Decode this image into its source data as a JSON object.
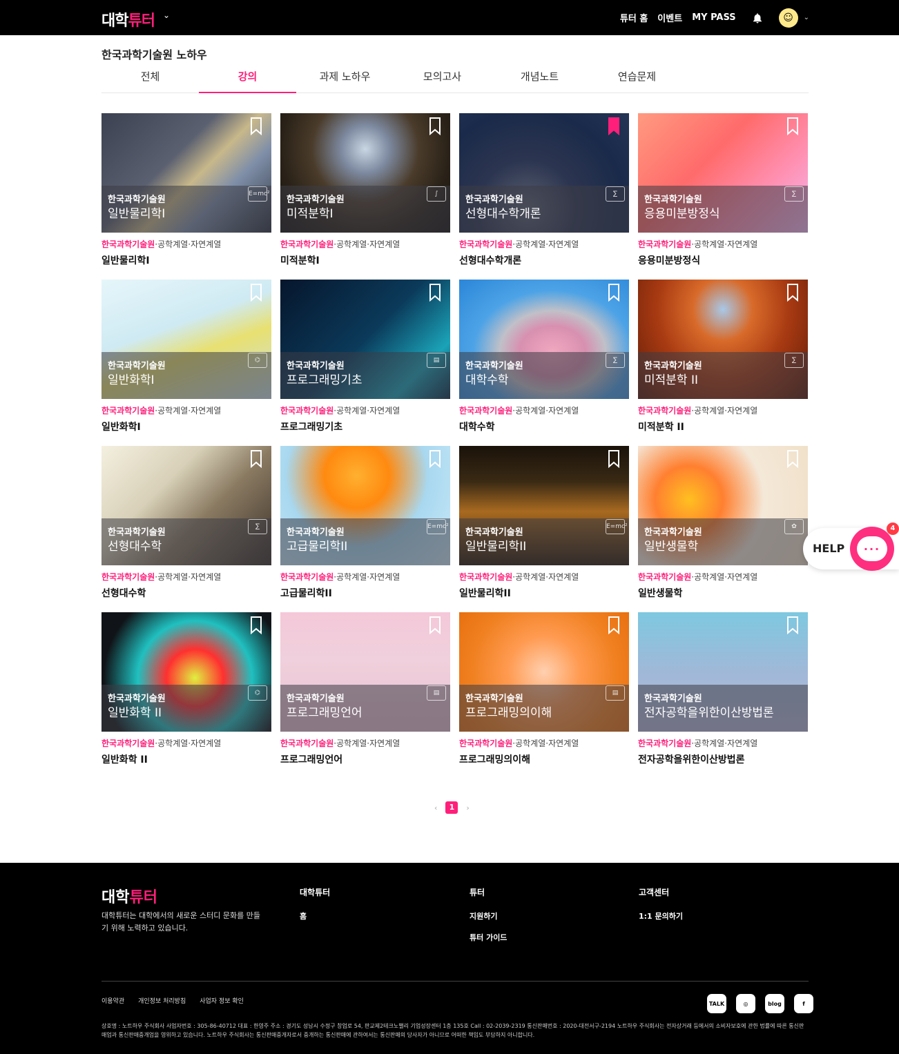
{
  "header": {
    "logo_main": "대학",
    "logo_accent": "튜터",
    "links": [
      "튜터 홈",
      "이벤트",
      "MY PASS"
    ]
  },
  "page": {
    "title": "한국과학기술원 노하우",
    "tabs": [
      "전체",
      "강의",
      "과제 노하우",
      "모의고사",
      "개념노트",
      "연습문제"
    ],
    "active_tab": "강의"
  },
  "cards": [
    {
      "uni": "한국과학기술원",
      "name": "일반물리학I",
      "tags": "·공학계열·자연계열",
      "title": "일반물리학I",
      "icon": "E=mc²",
      "bookmarked": false,
      "bg": "linear-gradient(135deg,#3b4150 0%,#5b6070 40%,#c8b88a 55%,#7f8fa8 70%,#2e3440 100%)"
    },
    {
      "uni": "한국과학기술원",
      "name": "미적분학I",
      "tags": "·공학계열·자연계열",
      "title": "미적분학I",
      "icon": "∫",
      "bookmarked": false,
      "bg": "radial-gradient(circle at 50% 30%,#c9d6e3 0%,#7d8aa0 20%,#4a3b2a 45%,#2a2218 70%,#151210 100%)"
    },
    {
      "uni": "한국과학기술원",
      "name": "선형대수학개론",
      "tags": "·공학계열·자연계열",
      "title": "선형대수학개론",
      "icon": "∑",
      "bookmarked": true,
      "bg": "radial-gradient(circle at 40% 80%,#5a6070 0%,#2c3550 35%,#1a2a4a 70%,#243556 100%)"
    },
    {
      "uni": "한국과학기술원",
      "name": "응용미분방정식",
      "tags": "·공학계열·자연계열",
      "title": "응용미분방정식",
      "icon": "∑",
      "bookmarked": false,
      "bg": "linear-gradient(135deg,#ff9a80 0%,#ff6b6b 40%,#ff8fb0 70%,#f3b8f0 100%)"
    },
    {
      "uni": "한국과학기술원",
      "name": "일반화학I",
      "tags": "·공학계열·자연계열",
      "title": "일반화학I",
      "icon": "⌬",
      "bookmarked": false,
      "bg": "linear-gradient(160deg,#e6f6fa 0%,#cfeaf3 40%,#e8e070 60%,#c8dfe8 100%)"
    },
    {
      "uni": "한국과학기술원",
      "name": "프로그래밍기초",
      "tags": "·공학계열·자연계열",
      "title": "프로그래밍기초",
      "icon": "▤",
      "bookmarked": false,
      "bg": "linear-gradient(135deg,#06162c 0%,#0b3a5a 50%,#1ba3b8 80%,#0a2f4a 100%)"
    },
    {
      "uni": "한국과학기술원",
      "name": "대학수학",
      "tags": "·공학계열·자연계열",
      "title": "대학수학",
      "icon": "∑",
      "bookmarked": false,
      "bg": "radial-gradient(ellipse at 55% 60%,#f0a8c0 0%,#d890b0 25%,#c0c0c8 40%,#4da3e6 60%,#2b86d8 100%)"
    },
    {
      "uni": "한국과학기술원",
      "name": "미적분학 II",
      "tags": "·공학계열·자연계열",
      "title": "미적분학 II",
      "icon": "∑",
      "bookmarked": false,
      "bg": "radial-gradient(ellipse at 50% 25%,#a8c8e8 0%,#d86a2a 25%,#a83a12 55%,#5a1a08 100%)"
    },
    {
      "uni": "한국과학기술원",
      "name": "선형대수학",
      "tags": "·공학계열·자연계열",
      "title": "선형대수학",
      "icon": "∑",
      "bookmarked": false,
      "bg": "linear-gradient(135deg,#f4f0e0 0%,#d8d0b8 35%,#8a7a62 60%,#3a3028 100%)"
    },
    {
      "uni": "한국과학기술원",
      "name": "고급물리학II",
      "tags": "·공학계열·자연계열",
      "title": "고급물리학II",
      "icon": "E=mc²",
      "bookmarked": false,
      "bg": "radial-gradient(circle at 45% 25%,#ffb030 0%,#ff8a10 25%,#a8d8f0 55%,#cfeaf8 100%)"
    },
    {
      "uni": "한국과학기술원",
      "name": "일반물리학II",
      "tags": "·공학계열·자연계열",
      "title": "일반물리학II",
      "icon": "E=mc²",
      "bookmarked": false,
      "bg": "linear-gradient(180deg,#1a120a 0%,#3a2a14 30%,#a86a20 55%,#2a1a0a 100%)"
    },
    {
      "uni": "한국과학기술원",
      "name": "일반생물학",
      "tags": "·공학계열·자연계열",
      "title": "일반생물학",
      "icon": "✿",
      "bookmarked": false,
      "bg": "radial-gradient(circle at 30% 45%,#ffc020 0%,#ff8030 25%,#f4e8d8 55%,#f0e0c8 100%)"
    },
    {
      "uni": "한국과학기술원",
      "name": "일반화학 II",
      "tags": "·공학계열·자연계열",
      "title": "일반화학 II",
      "icon": "⌬",
      "bookmarked": false,
      "bg": "radial-gradient(circle at 55% 55%,#e0f040 0%,#ff3030 25%,#20c0c0 50%,#101418 80%)"
    },
    {
      "uni": "한국과학기술원",
      "name": "프로그래밍언어",
      "tags": "·공학계열·자연계열",
      "title": "프로그래밍언어",
      "icon": "▤",
      "bookmarked": false,
      "bg": "linear-gradient(180deg,#f4c8d8 0%,#f0d0dc 40%,#e8c0d0 100%)"
    },
    {
      "uni": "한국과학기술원",
      "name": "프로그래밍의이해",
      "tags": "·공학계열·자연계열",
      "title": "프로그래밍의이해",
      "icon": "▤",
      "bookmarked": false,
      "bg": "radial-gradient(circle at 50% 50%,#ffd0b0 0%,#ff9a50 35%,#f08020 70%,#e87010 100%)"
    },
    {
      "uni": "한국과학기술원",
      "name": "전자공학을위한이산방법론",
      "tags": "·공학계열·자연계열",
      "title": "전자공학을위한이산방법론",
      "icon": "",
      "bookmarked": false,
      "bg": "linear-gradient(180deg,#7ec8e0 0%,#a0b8d8 50%,#b8b8d8 100%)"
    }
  ],
  "pagination": {
    "prev": "‹",
    "current": "1",
    "next": "›"
  },
  "help": {
    "label": "HELP",
    "badge": "4",
    "dots": "···"
  },
  "footer": {
    "logo_main": "대학",
    "logo_accent": "튜터",
    "desc": "대학튜터는 대학에서의 새로운 스터디 문화를 만들기 위해 노력하고 있습니다.",
    "col1": {
      "heading": "대학튜터",
      "items": [
        "홈"
      ]
    },
    "col2": {
      "heading": "튜터",
      "items": [
        "지원하기",
        "튜터 가이드"
      ]
    },
    "col3": {
      "heading": "고객센터",
      "items": [
        "1:1 문의하기"
      ]
    },
    "links": [
      "이용약관",
      "개인정보 처리방침",
      "사업자 정보 확인"
    ],
    "social": [
      "TALK",
      "◎",
      "blog",
      "f"
    ],
    "legal": "상호명 : 노트하우 주식회사 사업자번호 : 305-86-40712 대표 : 한영주 주소 : 경기도 성남시 수정구 창업로 54, 판교제2테크노밸리 기업성장센터 1층 135호 Call : 02-2039-2319 통신판매번호 : 2020-대전서구-2194 노트하우 주식회사는 전자상거래 등에서의 소비자보호에 관한 법률에 따른 통신판매업과 통신판매중개업을 영위하고 있습니다. 노트하우 주식회사는 통신판매중개자로서 중개하는 통신판매에 관하여서는 통신판매의 당사자가 아니므로 어떠한 책임도 부담하지 아니합니다."
  },
  "colors": {
    "accent": "#ff1f7a"
  }
}
